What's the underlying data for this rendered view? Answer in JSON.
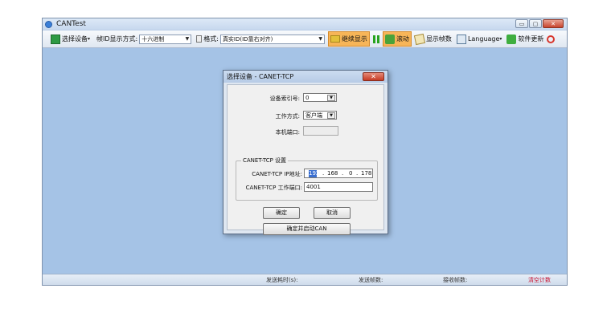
{
  "window": {
    "title": "CANTest",
    "controls": [
      "▭",
      "▢",
      "✕"
    ]
  },
  "toolbar": {
    "select_device": "选择设备",
    "frame_id_label": "帧ID显示方式:",
    "frame_id_value": "十六进制",
    "format_label": "格式:",
    "format_value": "真实ID(ID靠右对齐)",
    "continue_display": "继续显示",
    "scroll": "滚动",
    "show_frames": "显示帧数",
    "language": "Language",
    "software_update": "软件更新"
  },
  "statusbar": {
    "send_time": "发送耗时(s):",
    "send_frames": "发送帧数:",
    "recv_frames": "接收帧数:",
    "clear_count": "清空计数"
  },
  "dialog": {
    "title": "选择设备 - CANET-TCP",
    "close": "✕",
    "index_label": "设备索引号:",
    "index_value": "0",
    "mode_label": "工作方式:",
    "mode_value": "客户端",
    "local_port_label": "本机端口:",
    "local_port_value": "",
    "group_label": "CANET-TCP 设置",
    "ip_label": "CANET-TCP IP地址:",
    "ip_octets": [
      "192",
      "168",
      "0",
      "178"
    ],
    "port_label": "CANET-TCP 工作端口:",
    "port_value": "4001",
    "ok": "确定",
    "cancel": "取消",
    "ok_start": "确定并启动CAN"
  },
  "colors": {
    "workspace": "#a5c3e6",
    "active_toolbar": "#f7b558",
    "clear_count": "#c8102e"
  }
}
